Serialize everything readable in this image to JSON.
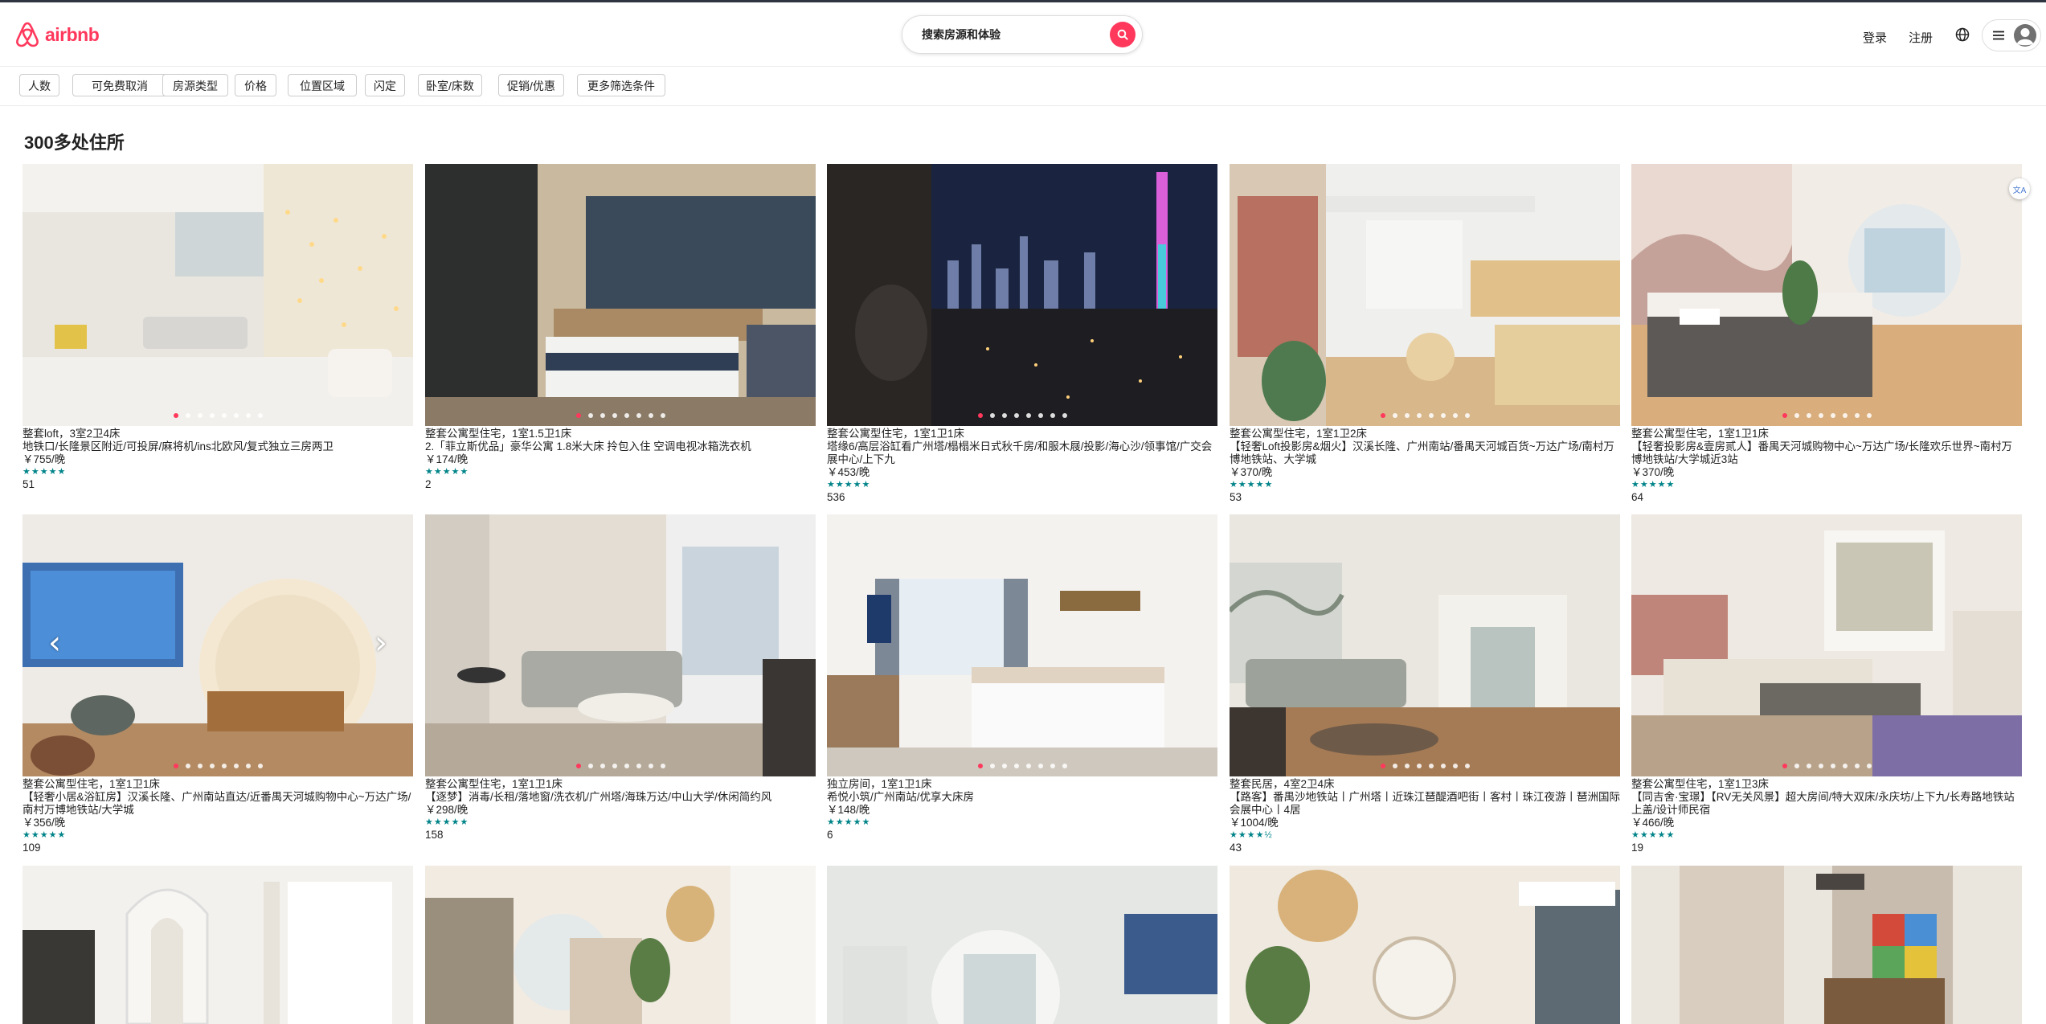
{
  "header": {
    "logo_text": "airbnb",
    "search_placeholder": "搜索房源和体验",
    "login": "登录",
    "signup": "注册"
  },
  "filters": [
    "人数",
    "可免费取消",
    "房源类型",
    "价格",
    "位置区域",
    "闪定",
    "卧室/床数",
    "促销/优惠",
    "更多筛选条件"
  ],
  "results_title": "300多处住所",
  "listings": [
    {
      "type": "整套loft，3室2卫4床",
      "title": "地铁口/长隆景区附近/可投屏/麻将机/ins北欧风/复式独立三房两卫",
      "price": "￥755/晚",
      "stars": "★★★★★",
      "reviews": "51"
    },
    {
      "type": "整套公寓型住宅，1室1.5卫1床",
      "title": "2.「菲立斯优品」豪华公寓 1.8米大床 拎包入住 空调电视冰箱洗衣机",
      "price": "￥174/晚",
      "stars": "★★★★★",
      "reviews": "2"
    },
    {
      "type": "整套公寓型住宅，1室1卫1床",
      "title": "塔缘6/高层浴缸看广州塔/榻榻米日式秋千房/和服木屐/投影/海心沙/领事馆/广交会展中心/上下九",
      "price": "￥453/晚",
      "stars": "★★★★★",
      "reviews": "536"
    },
    {
      "type": "整套公寓型住宅，1室1卫2床",
      "title": "【轻奢Loft投影房&烟火】汉溪长隆、广州南站/番禺天河城百货~万达广场/南村万博地铁站、大学城",
      "price": "￥370/晚",
      "stars": "★★★★★",
      "reviews": "53"
    },
    {
      "type": "整套公寓型住宅，1室1卫1床",
      "title": "【轻奢投影房&壹房贰人】番禺天河城购物中心~万达广场/长隆欢乐世界~南村万博地铁站/大学城近3站",
      "price": "￥370/晚",
      "stars": "★★★★★",
      "reviews": "64"
    },
    {
      "type": "整套公寓型住宅，1室1卫1床",
      "title": "【轻奢小居&浴缸房】汉溪长隆、广州南站直达/近番禺天河城购物中心~万达广场/南村万博地铁站/大学城",
      "price": "￥356/晚",
      "stars": "★★★★★",
      "reviews": "109"
    },
    {
      "type": "整套公寓型住宅，1室1卫1床",
      "title": "【逐梦】消毒/长租/落地窗/洗衣机/广州塔/海珠万达/中山大学/休闲简约风",
      "price": "￥298/晚",
      "stars": "★★★★★",
      "reviews": "158"
    },
    {
      "type": "独立房间，1室1卫1床",
      "title": "希悦小筑/广州南站/优享大床房",
      "price": "￥148/晚",
      "stars": "★★★★★",
      "reviews": "6"
    },
    {
      "type": "整套民居，4室2卫4床",
      "title": "【路客】番禺沙地铁站丨广州塔丨近珠江琶醍酒吧街丨客村丨珠江夜游丨琶洲国际会展中心丨4居",
      "price": "￥1004/晚",
      "stars": "★★★★½",
      "reviews": "43"
    },
    {
      "type": "整套公寓型住宅，1室1卫3床",
      "title": "【同吉舍·宝璟】【RV无关风景】超大房间/特大双床/永庆坊/上下九/长寿路地铁站上盖/设计师民宿",
      "price": "￥466/晚",
      "stars": "★★★★★",
      "reviews": "19"
    }
  ]
}
